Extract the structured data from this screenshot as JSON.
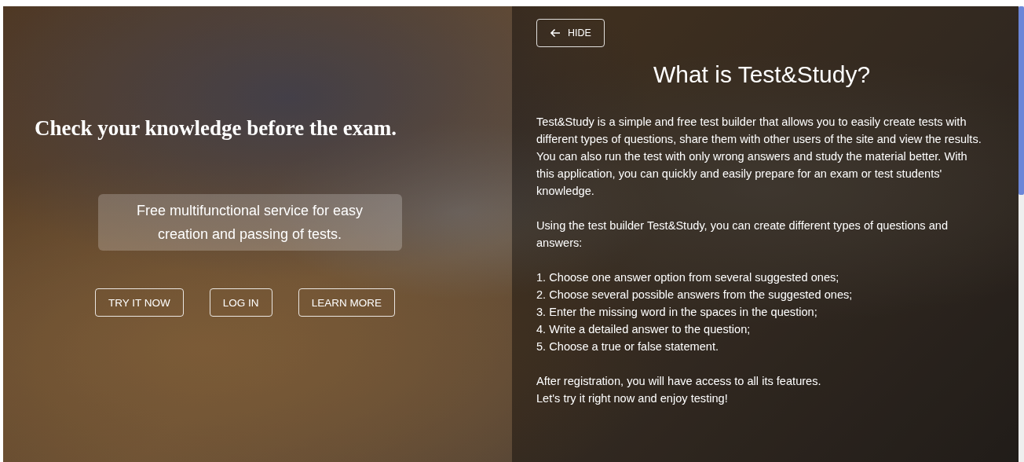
{
  "hero": {
    "heading": "Check your knowledge before the exam.",
    "subtitle": "Free multifunctional service for easy creation and passing of tests.",
    "buttons": [
      "TRY IT NOW",
      "LOG IN",
      "LEARN MORE"
    ]
  },
  "info_panel": {
    "hide_button": "HIDE",
    "title": "What is Test&Study?",
    "blocks": [
      {
        "lines": [
          "Test&Study is a simple and free test builder that allows you to easily create tests with different types of questions, share them with other users of the site and view the results. You can also run the test with only wrong answers and study the material better. With this application, you can quickly and easily prepare for an exam or test students' knowledge."
        ]
      },
      {
        "lines": [
          "Using the test builder Test&Study, you can create different types of questions and answers:"
        ]
      },
      {
        "lines": [
          "1. Choose one answer option from several suggested ones;",
          "2. Choose several possible answers from the suggested ones;",
          "3. Enter the missing word in the spaces in the question;",
          "4. Write a detailed answer to the question;",
          "5. Choose a true or false statement."
        ]
      },
      {
        "lines": [
          "After registration, you will have access to all its features.",
          "Let's try it right now and enjoy testing!"
        ]
      }
    ]
  }
}
